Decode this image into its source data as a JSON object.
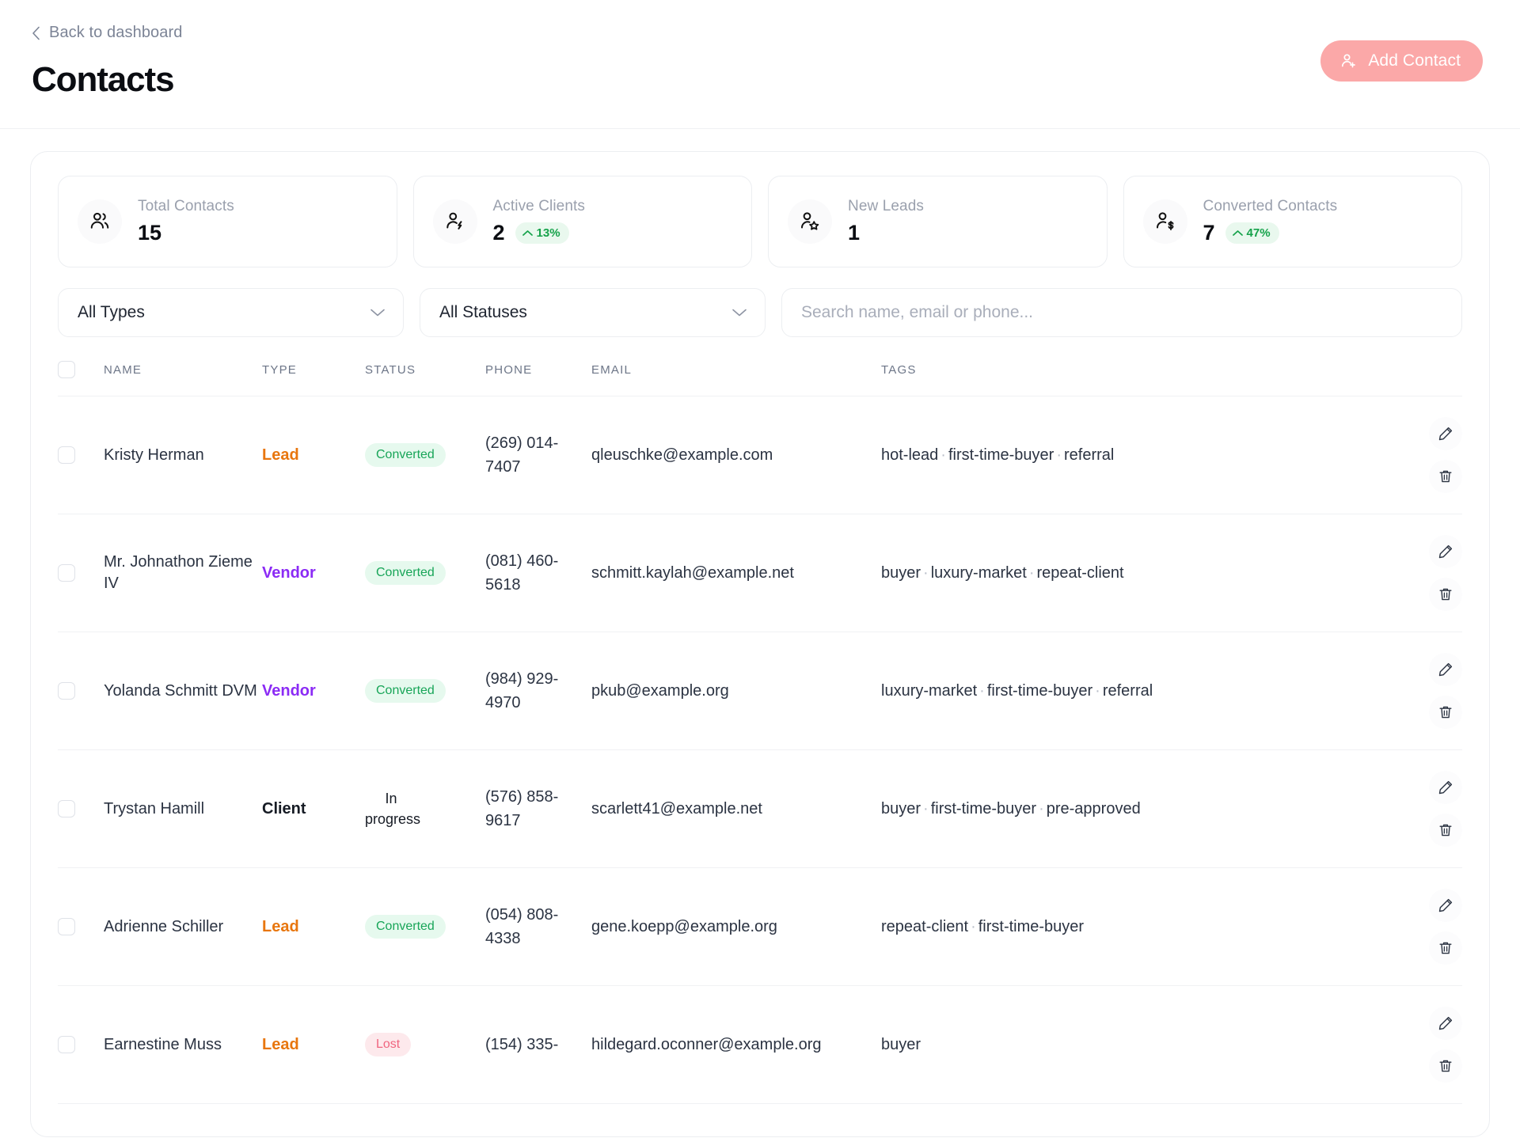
{
  "header": {
    "back_label": "Back to dashboard",
    "title": "Contacts",
    "add_button_label": "Add Contact",
    "accent_color": "#fba8a8"
  },
  "stats": [
    {
      "label": "Total Contacts",
      "value": "15",
      "icon": "users-icon",
      "trend": null
    },
    {
      "label": "Active Clients",
      "value": "2",
      "icon": "user-bolt-icon",
      "trend": "13%",
      "trend_color": "#15a24a"
    },
    {
      "label": "New Leads",
      "value": "1",
      "icon": "user-star-icon",
      "trend": null
    },
    {
      "label": "Converted Contacts",
      "value": "7",
      "icon": "user-dollar-icon",
      "trend": "47%",
      "trend_color": "#15a24a"
    }
  ],
  "filters": {
    "type_select": "All Types",
    "status_select": "All Statuses",
    "search_placeholder": "Search name, email or phone...",
    "search_value": ""
  },
  "table": {
    "columns": [
      "NAME",
      "TYPE",
      "STATUS",
      "PHONE",
      "EMAIL",
      "TAGS"
    ],
    "rows": [
      {
        "name": "Kristy Herman",
        "type": "Lead",
        "type_color": "#e8760e",
        "status": "Converted",
        "status_style": "badge-converted",
        "phone": "(269) 014-7407",
        "email": "qleuschke@example.com",
        "tags": [
          "hot-lead",
          "first-time-buyer",
          "referral"
        ]
      },
      {
        "name": "Mr. Johnathon Zieme IV",
        "type": "Vendor",
        "type_color": "#8b2bf5",
        "status": "Converted",
        "status_style": "badge-converted",
        "phone": "(081) 460-5618",
        "email": "schmitt.kaylah@example.net",
        "tags": [
          "buyer",
          "luxury-market",
          "repeat-client"
        ]
      },
      {
        "name": "Yolanda Schmitt DVM",
        "type": "Vendor",
        "type_color": "#8b2bf5",
        "status": "Converted",
        "status_style": "badge-converted",
        "phone": "(984) 929-4970",
        "email": "pkub@example.org",
        "tags": [
          "luxury-market",
          "first-time-buyer",
          "referral"
        ]
      },
      {
        "name": "Trystan Hamill",
        "type": "Client",
        "type_color": "#161b24",
        "status": "In progress",
        "status_style": "status-plain",
        "phone": "(576) 858-9617",
        "email": "scarlett41@example.net",
        "tags": [
          "buyer",
          "first-time-buyer",
          "pre-approved"
        ]
      },
      {
        "name": "Adrienne Schiller",
        "type": "Lead",
        "type_color": "#e8760e",
        "status": "Converted",
        "status_style": "badge-converted",
        "phone": "(054) 808-4338",
        "email": "gene.koepp@example.org",
        "tags": [
          "repeat-client",
          "first-time-buyer"
        ]
      },
      {
        "name": "Earnestine Muss",
        "type": "Lead",
        "type_color": "#e8760e",
        "status": "Lost",
        "status_style": "badge-lost",
        "phone": "(154) 335-",
        "email": "hildegard.oconner@example.org",
        "tags": [
          "buyer"
        ]
      }
    ],
    "edit_icon": "pencil-icon",
    "delete_icon": "trash-icon"
  }
}
